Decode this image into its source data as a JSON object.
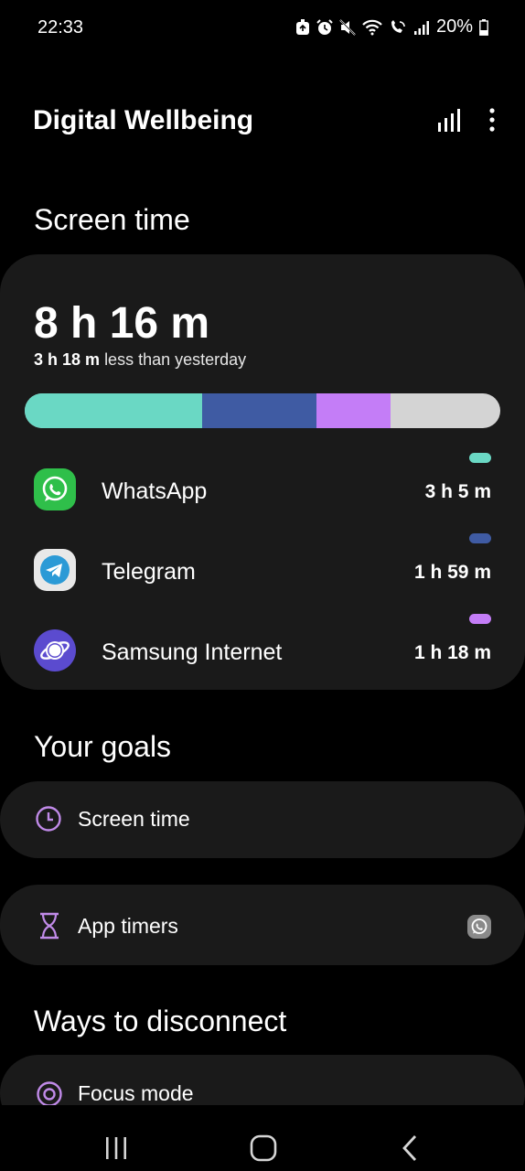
{
  "status": {
    "time": "22:33",
    "battery": "20%",
    "icons": [
      "recycle-icon",
      "alarm-icon",
      "mute-icon",
      "wifi-icon",
      "volte-call-icon",
      "signal-icon",
      "battery-icon"
    ]
  },
  "header": {
    "title": "Digital Wellbeing",
    "icons": [
      "chart-icon",
      "more-vert-icon"
    ]
  },
  "screen_time": {
    "section_title": "Screen time",
    "total": "8 h 16 m",
    "delta_value": "3 h 18 m",
    "delta_text": "less than yesterday",
    "apps": [
      {
        "name": "WhatsApp",
        "time": "3 h 5 m",
        "color": "#6ad8c4",
        "minutes": 185
      },
      {
        "name": "Telegram",
        "time": "1 h 59 m",
        "color": "#3f5ba3",
        "minutes": 119
      },
      {
        "name": "Samsung Internet",
        "time": "1 h 18 m",
        "color": "#c47df7",
        "minutes": 78
      }
    ],
    "other_color": "#d4d4d4"
  },
  "goals": {
    "section_title": "Your goals",
    "items": [
      {
        "label": "Screen time",
        "icon": "clock-icon"
      },
      {
        "label": "App timers",
        "icon": "hourglass-icon",
        "trailing_icon": "whatsapp-icon"
      }
    ]
  },
  "disconnect": {
    "section_title": "Ways to disconnect",
    "items": [
      {
        "label": "Focus mode",
        "icon": "focus-icon"
      }
    ]
  },
  "nav": [
    "recents-button",
    "home-button",
    "back-button"
  ],
  "accent": "#c08ae8"
}
